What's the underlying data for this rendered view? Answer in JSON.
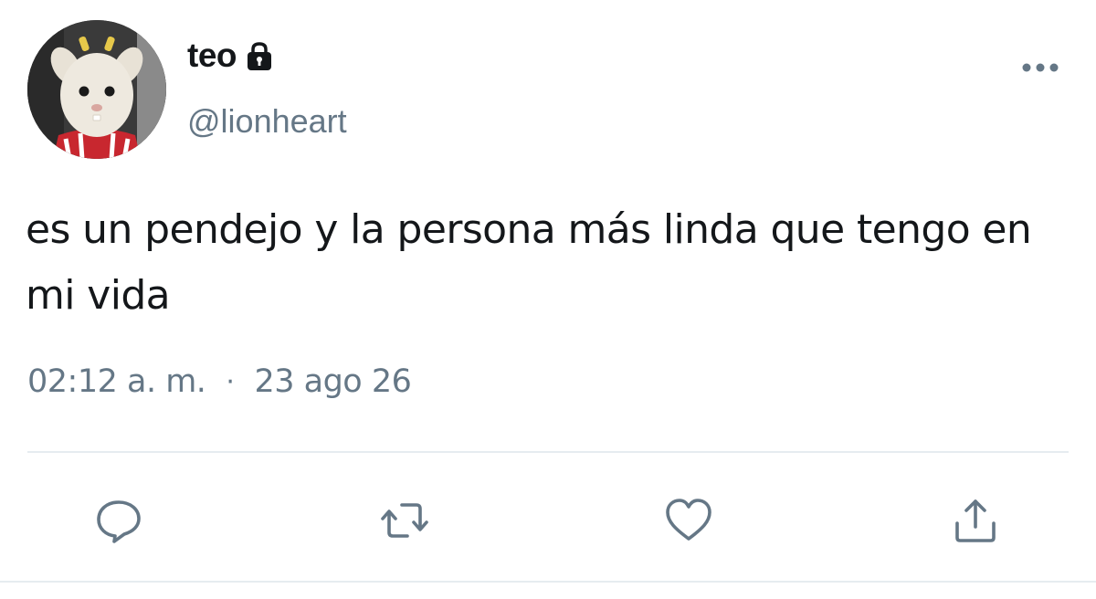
{
  "tweet": {
    "author": {
      "display_name": "teo",
      "handle": "@lionheart",
      "protected_icon": "lock-icon",
      "avatar": "avatar-image"
    },
    "text": "es un pendejo y la persona más linda que tengo en mi vida",
    "time": "02:12 a. m.",
    "separator": "·",
    "date": "23 ago 26"
  },
  "actions": {
    "more": "more-icon",
    "reply": "reply-icon",
    "retweet": "retweet-icon",
    "like": "like-icon",
    "share": "share-icon"
  },
  "colors": {
    "text": "#14171a",
    "secondary": "#657786",
    "divider": "#e6ecf0"
  }
}
